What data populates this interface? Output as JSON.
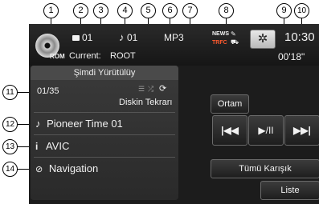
{
  "callouts": [
    "1",
    "2",
    "3",
    "4",
    "5",
    "6",
    "7",
    "8",
    "9",
    "10",
    "11",
    "12",
    "13",
    "14"
  ],
  "header": {
    "disc_label": "ROM",
    "folder_number": "01",
    "track_number": "01",
    "current_label": "Current:",
    "current_folder": "ROOT",
    "format": "MP3",
    "news_label": "NEWS",
    "trfc_label": "TRFC",
    "clock": "10:30",
    "elapsed": "00'18\""
  },
  "panel": {
    "title": "Şimdi Yürütülüy",
    "track_count": "01/35",
    "repeat_label": "Diskin Tekrarı",
    "track_title": "Pioneer Time 01",
    "artist": "AVIC",
    "album": "Navigation"
  },
  "controls": {
    "source_button": "Ortam",
    "prev_label": "|◀◀",
    "playpause_label": "▶/II",
    "next_label": "▶▶|",
    "shuffle_button": "Tümü Karışık",
    "list_button": "Liste"
  },
  "colors": {
    "screen_bg": "#1c1c1c",
    "panel_bg": "#2e2e2e",
    "text": "#f2f2f2"
  }
}
